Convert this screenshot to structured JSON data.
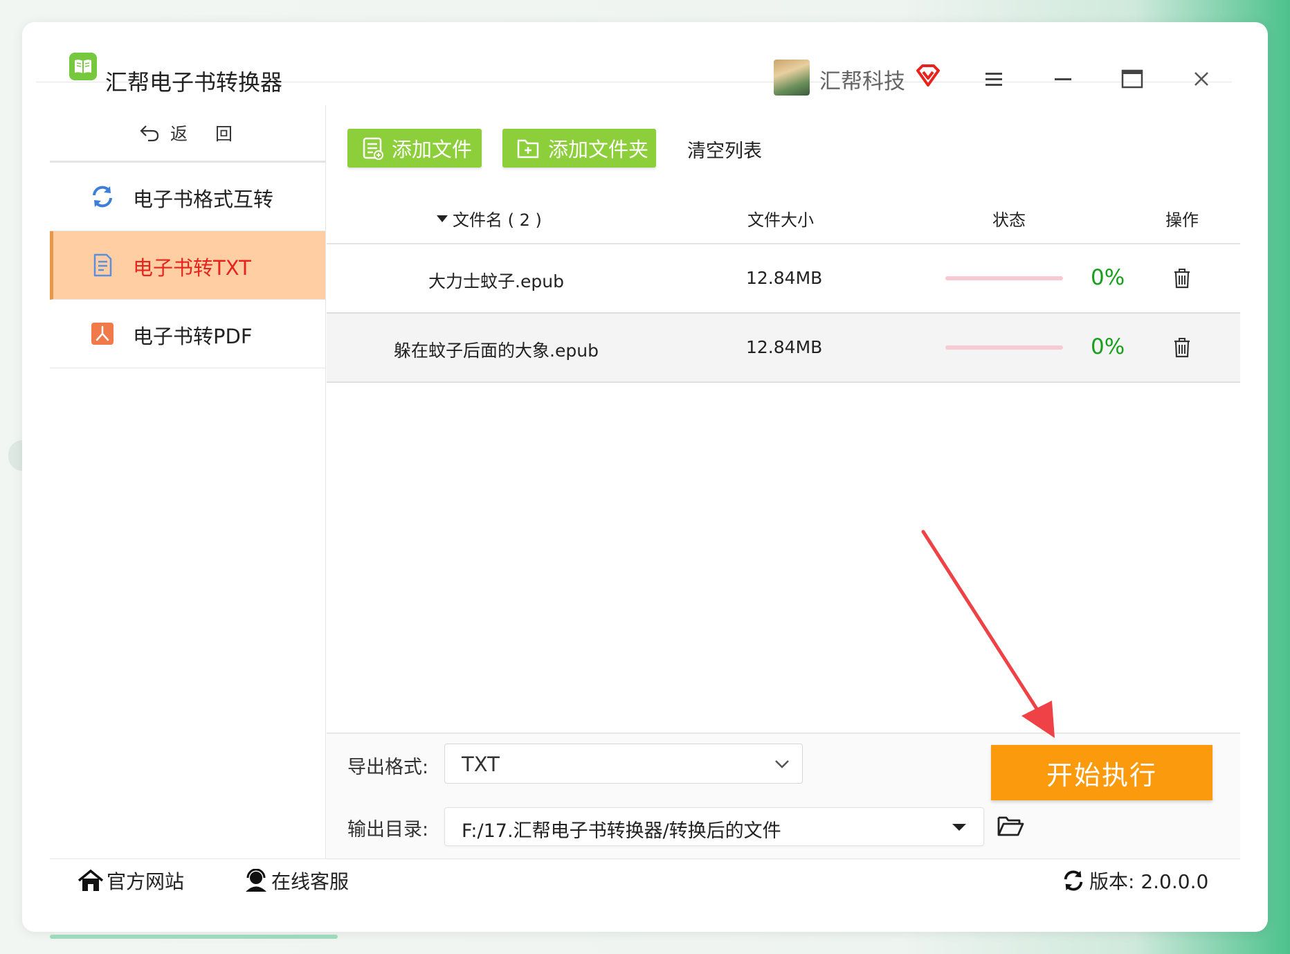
{
  "app": {
    "title": "汇帮电子书转换器"
  },
  "user": {
    "name": "汇帮科技"
  },
  "sidebar": {
    "back_label": "返",
    "back_label2": "回",
    "items": [
      {
        "label": "电子书格式互转",
        "icon": "refresh-icon",
        "active": false
      },
      {
        "label": "电子书转TXT",
        "icon": "document-icon",
        "active": true
      },
      {
        "label": "电子书转PDF",
        "icon": "pdf-icon",
        "active": false
      }
    ]
  },
  "toolbar": {
    "add_file": "添加文件",
    "add_folder": "添加文件夹",
    "clear_list": "清空列表"
  },
  "table": {
    "headers": {
      "name": "文件名 ( 2 )",
      "size": "文件大小",
      "status": "状态",
      "action": "操作"
    },
    "rows": [
      {
        "name": "大力士蚊子.epub",
        "size": "12.84MB",
        "progress": "0%"
      },
      {
        "name": "躲在蚊子后面的大象.epub",
        "size": "12.84MB",
        "progress": "0%"
      }
    ]
  },
  "export": {
    "format_label": "导出格式:",
    "format_value": "TXT",
    "dir_label": "输出目录:",
    "dir_value": "F:/17.汇帮电子书转换器/转换后的文件",
    "start_label": "开始执行"
  },
  "footer": {
    "website": "官方网站",
    "support": "在线客服",
    "version": "版本:  2.0.0.0"
  },
  "colors": {
    "accent_green": "#8ccf3a",
    "active_bg": "#ffcfa3",
    "active_text": "#e8221c",
    "start_orange": "#fa9a0c",
    "progress_green": "#17a01a",
    "arrow_red": "#ef4246"
  }
}
